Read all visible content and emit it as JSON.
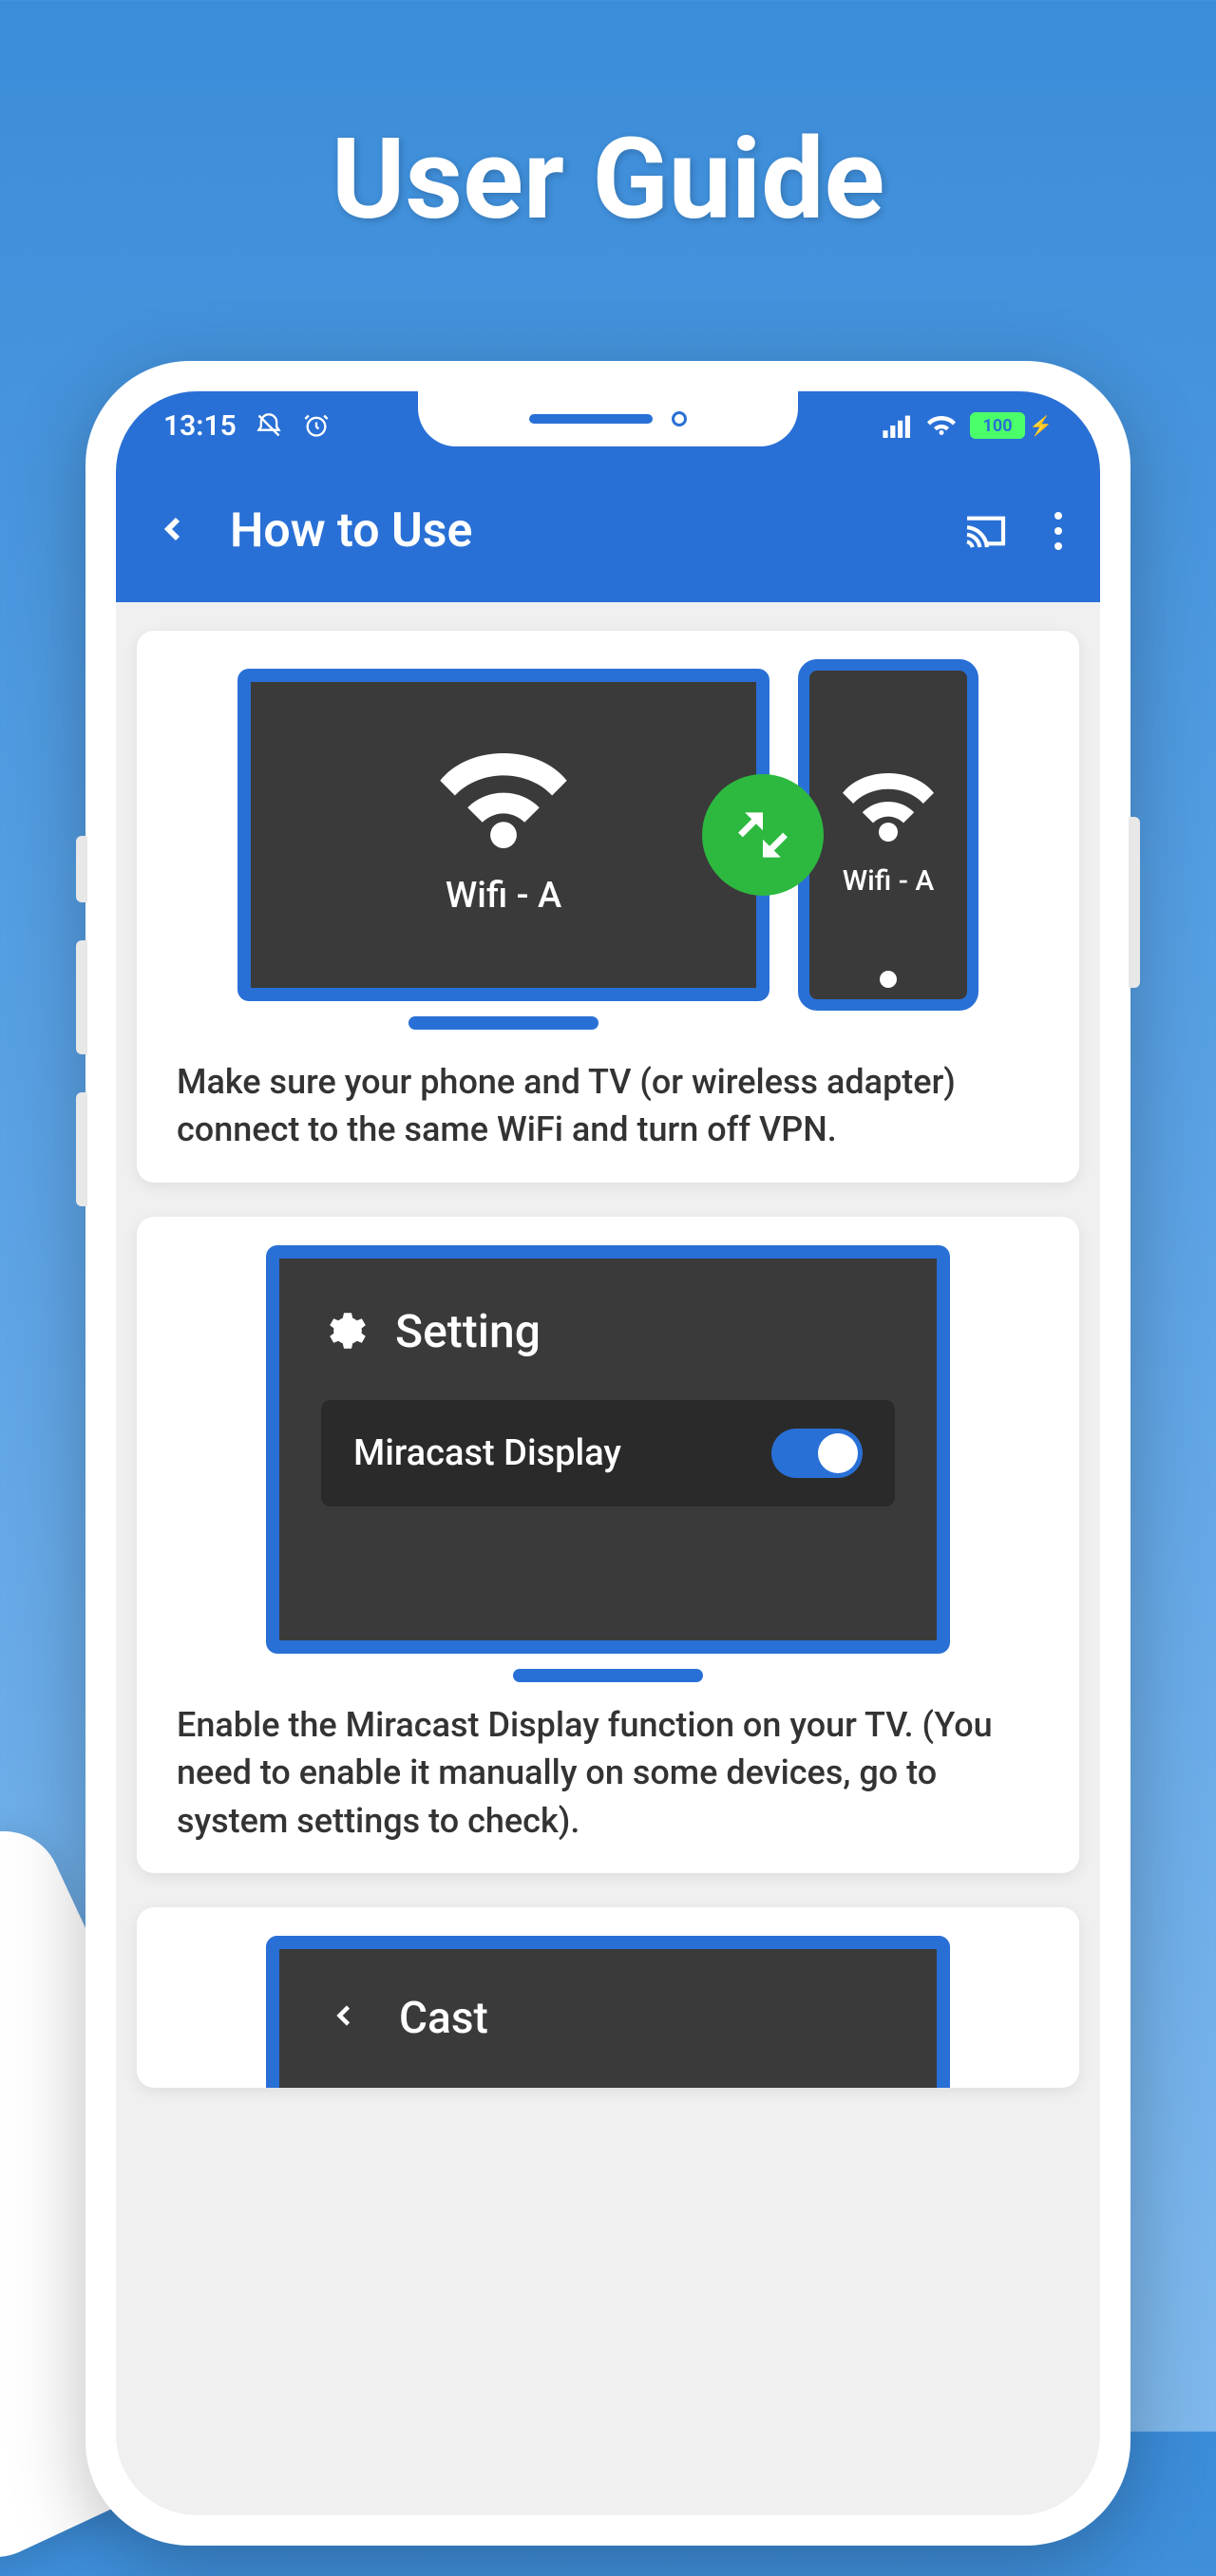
{
  "page": {
    "title": "User Guide"
  },
  "statusBar": {
    "time": "13:15",
    "battery": "100"
  },
  "header": {
    "title": "How to Use"
  },
  "cards": {
    "wifi": {
      "tvLabel": "Wifi - A",
      "phoneLabel": "Wifi - A",
      "description": "Make sure your phone and TV (or wireless adapter) connect to the same WiFi and turn off VPN."
    },
    "settings": {
      "title": "Setting",
      "toggleLabel": "Miracast Display",
      "description": "Enable the Miracast Display function on your TV. (You need to enable it manually on some devices, go to system settings to check)."
    },
    "cast": {
      "title": "Cast"
    }
  }
}
